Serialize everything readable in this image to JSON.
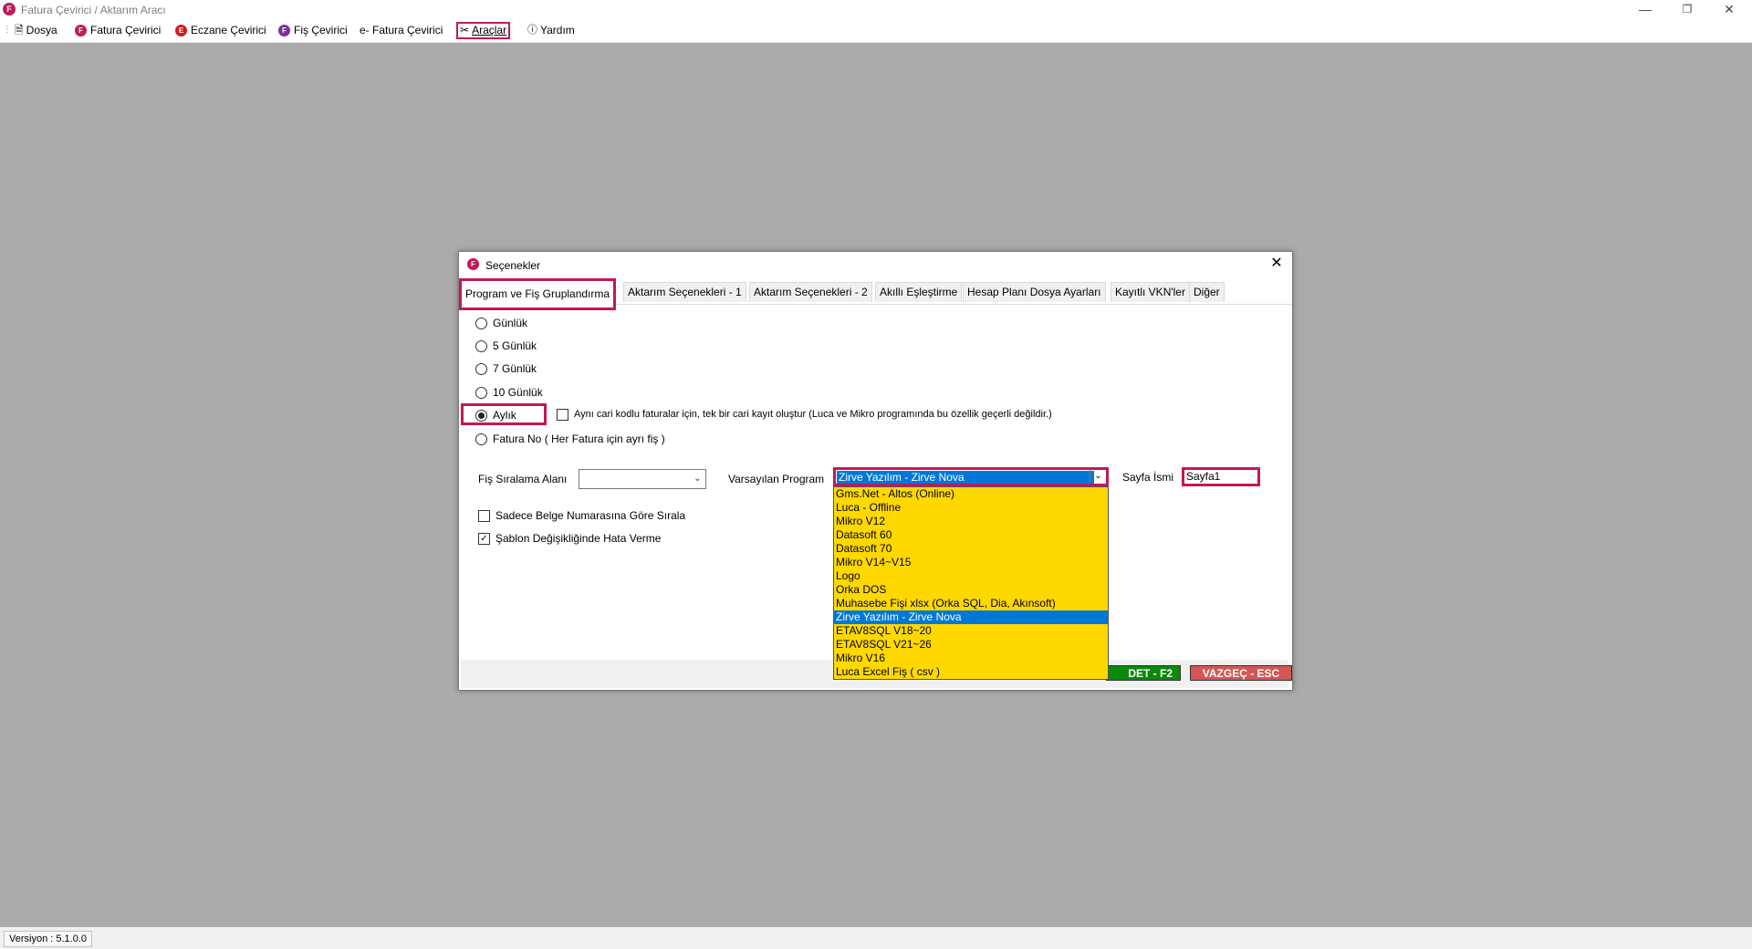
{
  "window": {
    "title": "Fatura Çevirici / Aktarım Aracı"
  },
  "menu": [
    {
      "label": "Dosya",
      "icon": "document-icon"
    },
    {
      "label": "Fatura Çevirici",
      "icon": "f-logo-icon"
    },
    {
      "label": "Eczane Çevirici",
      "icon": "e-logo-icon"
    },
    {
      "label": "Fiş Çevirici",
      "icon": "f-purple-logo-icon"
    },
    {
      "label": "e- Fatura Çevirici",
      "icon": "efatura-icon"
    },
    {
      "label": "Araçlar",
      "icon": "tools-icon"
    },
    {
      "label": "Yardım",
      "icon": "help-icon"
    }
  ],
  "status": {
    "version": "Versiyon : 5.1.0.0"
  },
  "dialog": {
    "title": "Seçenekler",
    "tabs": [
      "Program ve Fiş Gruplandırma",
      "Aktarım Seçenekleri - 1",
      "Aktarım Seçenekleri - 2",
      "Akıllı Eşleştirme",
      "Hesap Planı Dosya Ayarları",
      "Kayıtlı VKN'ler",
      "Diğer"
    ],
    "radios": [
      "Günlük",
      "5 Günlük",
      "7 Günlük",
      "10 Günlük",
      "Aylık",
      "Fatura No  ( Her Fatura için ayrı fiş )"
    ],
    "selected_radio": "Aylık",
    "same_cari_checkbox": "Aynı cari kodlu faturalar için, tek bir cari kayıt oluştur  (Luca ve Mikro programında bu özellik geçerli değildir.)",
    "fis_siralama_label": "Fiş Sıralama Alanı",
    "varsayilan_label": "Varsayılan Program",
    "varsayilan_value": "Zirve Yazılım - Zirve Nova",
    "sayfa_label": "Sayfa İsmi",
    "sayfa_value": "Sayfa1",
    "checkbox_sadece": "Sadece Belge Numarasına Göre Sırala",
    "checkbox_sablon": "Şablon Değişikliğinde Hata Verme",
    "program_options": [
      "Gms.Net - Altos (Online)",
      "Luca - Offline",
      "Mikro V12",
      "Datasoft 60",
      "Datasoft 70",
      "Mikro V14~V15",
      "Logo",
      "Orka DOS",
      "Muhasebe Fişi xlsx (Orka SQL, Dia, Akınsoft)",
      "Zirve Yazılım - Zirve Nova",
      "ETAV8SQL V18~20",
      "ETAV8SQL V21~26",
      "Mikro V16",
      "Luca Excel Fiş ( csv )"
    ],
    "save_label": "DET - F2",
    "cancel_label": "VAZGEÇ - ESC"
  }
}
